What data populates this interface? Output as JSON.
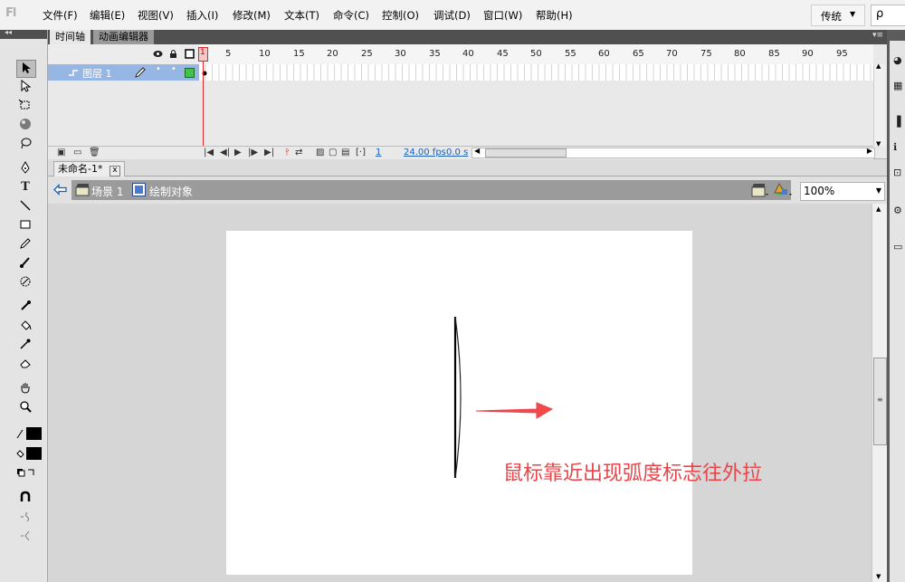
{
  "app": {
    "logo": "Fl"
  },
  "menu": {
    "items": [
      "文件(F)",
      "编辑(E)",
      "视图(V)",
      "插入(I)",
      "修改(M)",
      "文本(T)",
      "命令(C)",
      "控制(O)",
      "调试(D)",
      "窗口(W)",
      "帮助(H)"
    ],
    "workspace": "传统",
    "search_glyph": "ρ"
  },
  "timeline": {
    "tabs": [
      "时间轴",
      "动画编辑器"
    ],
    "layer_name": "图层 1",
    "ruler": [
      "5",
      "10",
      "15",
      "20",
      "25",
      "30",
      "35",
      "40",
      "45",
      "50",
      "55",
      "60",
      "65",
      "70",
      "75",
      "80",
      "85",
      "90",
      "95"
    ],
    "playhead_frame": "1",
    "current_frame": "1",
    "fps": "24.00 fps",
    "elapsed": "0.0 s"
  },
  "document": {
    "tab_title": "未命名-1*",
    "close_glyph": "x"
  },
  "editbar": {
    "scene": "场景 1",
    "object": "绘制对象",
    "zoom": "100%"
  },
  "stage": {
    "annotation": "鼠标靠近出现弧度标志往外拉",
    "annotation_color": "#e8454a"
  },
  "icons": [
    "back-arrow-icon",
    "scene-icon",
    "drawing-object-icon",
    "edit-scene-icon",
    "edit-symbol-icon",
    "eye-icon",
    "lock-icon",
    "outline-icon",
    "pencil-icon"
  ]
}
